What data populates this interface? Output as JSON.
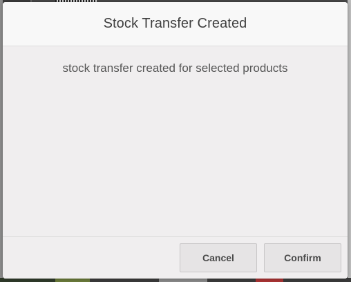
{
  "dialog": {
    "title": "Stock Transfer Created",
    "message": "stock transfer created for selected products",
    "cancel_label": "Cancel",
    "confirm_label": "Confirm"
  },
  "colors": {
    "modal_background": "#f0eeef",
    "header_background": "#f8f8f8",
    "button_background": "#e6e4e5",
    "overlay": "#4a4a4a"
  }
}
